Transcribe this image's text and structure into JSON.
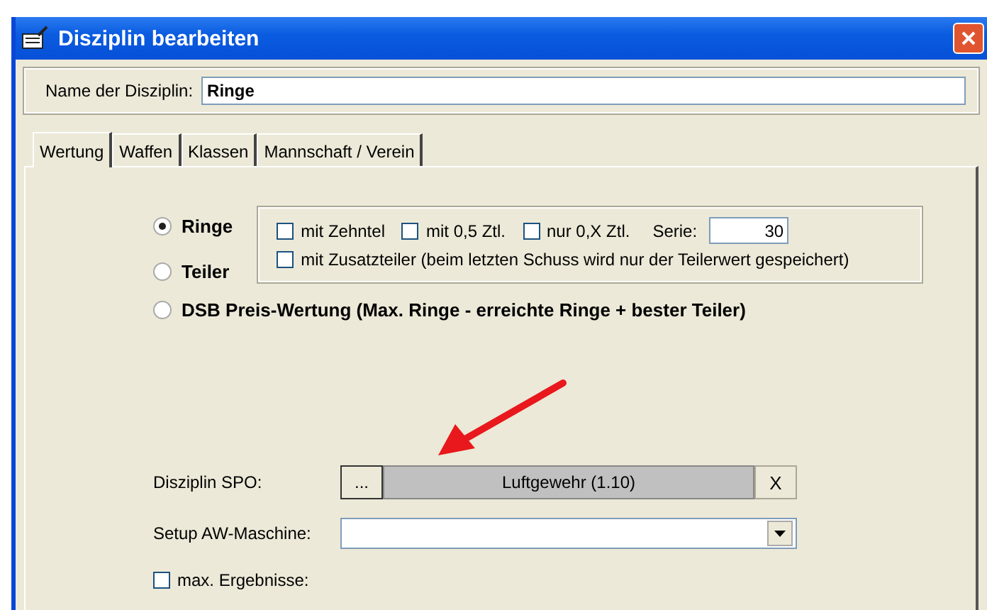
{
  "window": {
    "title": "Disziplin bearbeiten"
  },
  "name_field": {
    "label": "Name der Disziplin:",
    "value": "Ringe"
  },
  "tabs": [
    {
      "label": "Wertung",
      "selected": true
    },
    {
      "label": "Waffen",
      "selected": false
    },
    {
      "label": "Klassen",
      "selected": false
    },
    {
      "label": "Mannschaft / Verein",
      "selected": false
    }
  ],
  "scoring_modes": [
    {
      "label": "Ringe",
      "selected": true
    },
    {
      "label": "Teiler",
      "selected": false
    },
    {
      "label": "DSB Preis-Wertung (Max. Ringe - erreichte Ringe + bester Teiler)",
      "selected": false
    }
  ],
  "ring_options": [
    {
      "label": "mit Zehntel",
      "checked": false
    },
    {
      "label": "mit 0,5 Ztl.",
      "checked": false
    },
    {
      "label": "nur 0,X Ztl.",
      "checked": false
    }
  ],
  "series": {
    "label": "Serie:",
    "value": "30"
  },
  "extra_option": {
    "label": "mit Zusatzteiler (beim letzten Schuss wird nur der Teilerwert gespeichert)",
    "checked": false
  },
  "spo": {
    "label": "Disziplin SPO:",
    "browse": "...",
    "value": "Luftgewehr (1.10)",
    "clear": "X"
  },
  "setup": {
    "label": "Setup AW-Maschine:"
  },
  "max_results": {
    "label": "max. Ergebnisse:",
    "checked": false
  }
}
